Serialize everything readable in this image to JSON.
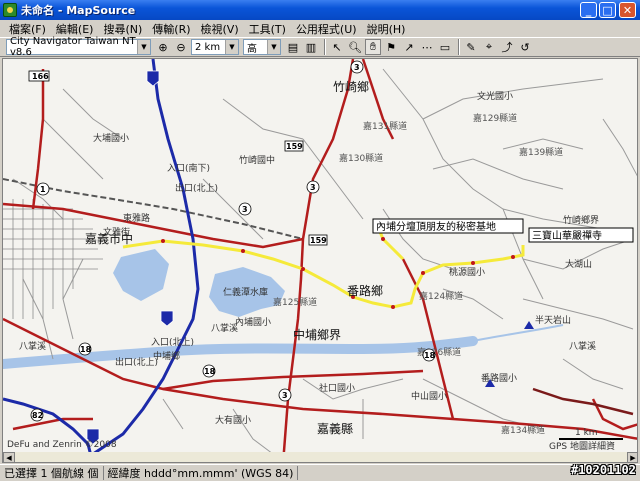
{
  "window": {
    "title": "未命名 - MapSource",
    "buttons": {
      "minimize": "_",
      "maximize": "□",
      "close": "✕"
    }
  },
  "menu": [
    "檔案(F)",
    "編輯(E)",
    "搜尋(N)",
    "傳輸(R)",
    "檢視(V)",
    "工具(T)",
    "公用程式(U)",
    "說明(H)"
  ],
  "toolbar": {
    "map_product": "City Navigator Taiwan NT v8.6",
    "zoom_scale": "2 km",
    "detail_level": "高"
  },
  "map": {
    "towns": [
      {
        "name": "竹崎鄉"
      },
      {
        "name": "番路鄉"
      },
      {
        "name": "中埔鄉界"
      },
      {
        "name": "嘉義縣"
      },
      {
        "name": "竹崎鄉界"
      },
      {
        "name": "大湖山"
      },
      {
        "name": "文雅街"
      },
      {
        "name": "嘉義市中"
      },
      {
        "name": "仁義潭水庫"
      },
      {
        "name": "八掌溪"
      },
      {
        "name": "中埔鄉"
      },
      {
        "name": "八掌溪"
      },
      {
        "name": "半天岩山"
      },
      {
        "name": "東雅路"
      }
    ],
    "labels": [
      {
        "text": "入口(南下)"
      },
      {
        "text": "出口(北上)"
      },
      {
        "text": "入口(北上)"
      },
      {
        "text": "出口(北上)"
      },
      {
        "text": "大埔國小"
      },
      {
        "text": "竹崎國中"
      },
      {
        "text": "桃源國小"
      },
      {
        "text": "內埔國小"
      },
      {
        "text": "八掌溪"
      },
      {
        "text": "社口國小"
      },
      {
        "text": "中山國小"
      },
      {
        "text": "文光國小"
      },
      {
        "text": "番路國小"
      },
      {
        "text": "大有國小"
      },
      {
        "text": "嘉129縣道"
      },
      {
        "text": "嘉139縣道"
      },
      {
        "text": "嘉131縣道"
      },
      {
        "text": "嘉130縣道"
      },
      {
        "text": "嘉124縣道"
      },
      {
        "text": "嘉125縣道"
      },
      {
        "text": "嘉126縣道"
      },
      {
        "text": "嘉134縣道"
      }
    ],
    "shields": [
      "166",
      "3",
      "1",
      "3",
      "3",
      "18",
      "18",
      "18",
      "82",
      "3",
      "159",
      "159"
    ],
    "callouts": [
      {
        "text": "內埔分壇頂朋友的秘密基地"
      },
      {
        "text": "三寶山華嚴禪寺"
      }
    ],
    "scale_text": "1 km",
    "copyright": "DeFu and Zenrin ©2008",
    "gps_label": "GPS 地圖詳細資"
  },
  "status": {
    "selection": "已選擇 1 個航線 個",
    "coord_format": "經緯度 hddd°mm.mmm' (WGS 84)"
  },
  "watermark": "#10201102",
  "colors": {
    "titlebar": "#0a55d8",
    "route": "#f5ea3a",
    "highway": "#1c2aa8",
    "main_road": "#b31d1d",
    "water": "#a7c4e8"
  }
}
